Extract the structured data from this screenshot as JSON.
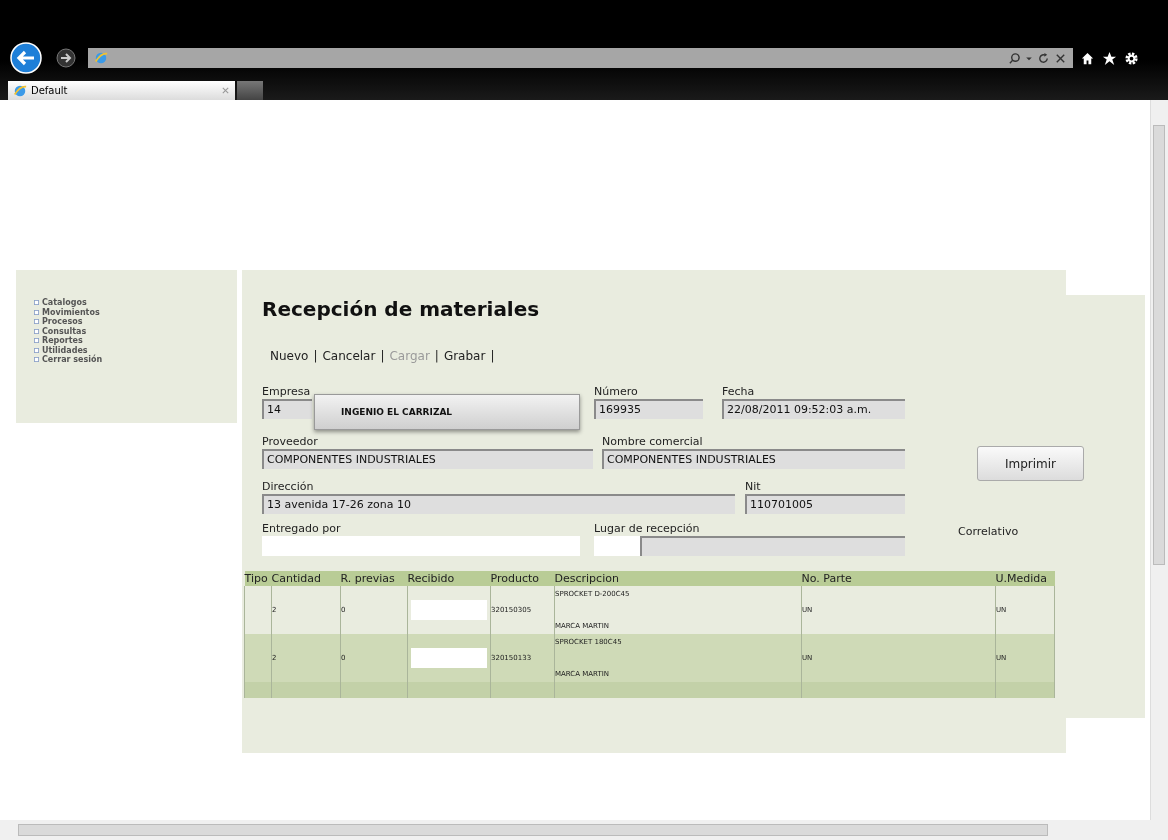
{
  "browser": {
    "tab": {
      "title": "Default"
    }
  },
  "sidebar": {
    "items": [
      {
        "label": "Catalogos"
      },
      {
        "label": "Movimientos"
      },
      {
        "label": "Procesos"
      },
      {
        "label": "Consultas"
      },
      {
        "label": "Reportes"
      },
      {
        "label": "Utilidades"
      },
      {
        "label": "Cerrar sesión"
      }
    ]
  },
  "page": {
    "title": "Recepción de materiales",
    "separator": "|",
    "actions": [
      {
        "label": "Nuevo",
        "disabled": false
      },
      {
        "label": "Cancelar",
        "disabled": false
      },
      {
        "label": "Cargar",
        "disabled": true
      },
      {
        "label": "Grabar",
        "disabled": false
      }
    ]
  },
  "form": {
    "rows": [
      [
        {
          "label": "Empresa",
          "value": "14",
          "kind": "readonly"
        },
        {
          "label": "Número",
          "value": "169935",
          "kind": "readonly"
        },
        {
          "label": "Fecha",
          "value": "22/08/2011 09:52:03 a.m.",
          "kind": "readonly"
        }
      ],
      [
        {
          "label": "Proveedor",
          "value": "COMPONENTES INDUSTRIALES",
          "kind": "readonly"
        },
        {
          "label": "Nombre comercial",
          "value": "COMPONENTES INDUSTRIALES",
          "kind": "readonly"
        }
      ],
      [
        {
          "label": "Dirección",
          "value": "13 avenida 17-26 zona 10",
          "kind": "readonly"
        },
        {
          "label": "Nit",
          "value": "110701005",
          "kind": "readonly"
        }
      ],
      [
        {
          "label": "Entregado por",
          "kind": "input"
        },
        {
          "label": "Lugar de recepción",
          "kind": "split"
        }
      ]
    ],
    "dropdown": {
      "value": "INGENIO EL CARRIZAL"
    },
    "print_button": "Imprimir",
    "correlativo_label": "Correlativo"
  },
  "table": {
    "columns": [
      "Tipo",
      "Cantidad",
      "R. previas",
      "Recibido",
      "Producto",
      "Descripcion",
      "No. Parte",
      "U.Medida"
    ],
    "rows": [
      {
        "cantidad": "2",
        "previas": "0",
        "producto": "320150305",
        "descripcion": "SPROCKET D-200C45",
        "marca": "MARCA MARTIN",
        "parte": "UN",
        "medida": "UN"
      },
      {
        "cantidad": "2",
        "previas": "0",
        "producto": "320150133",
        "descripcion": "SPROCKET 180C45",
        "marca": "MARCA MARTIN",
        "parte": "UN",
        "medida": "UN"
      }
    ]
  }
}
